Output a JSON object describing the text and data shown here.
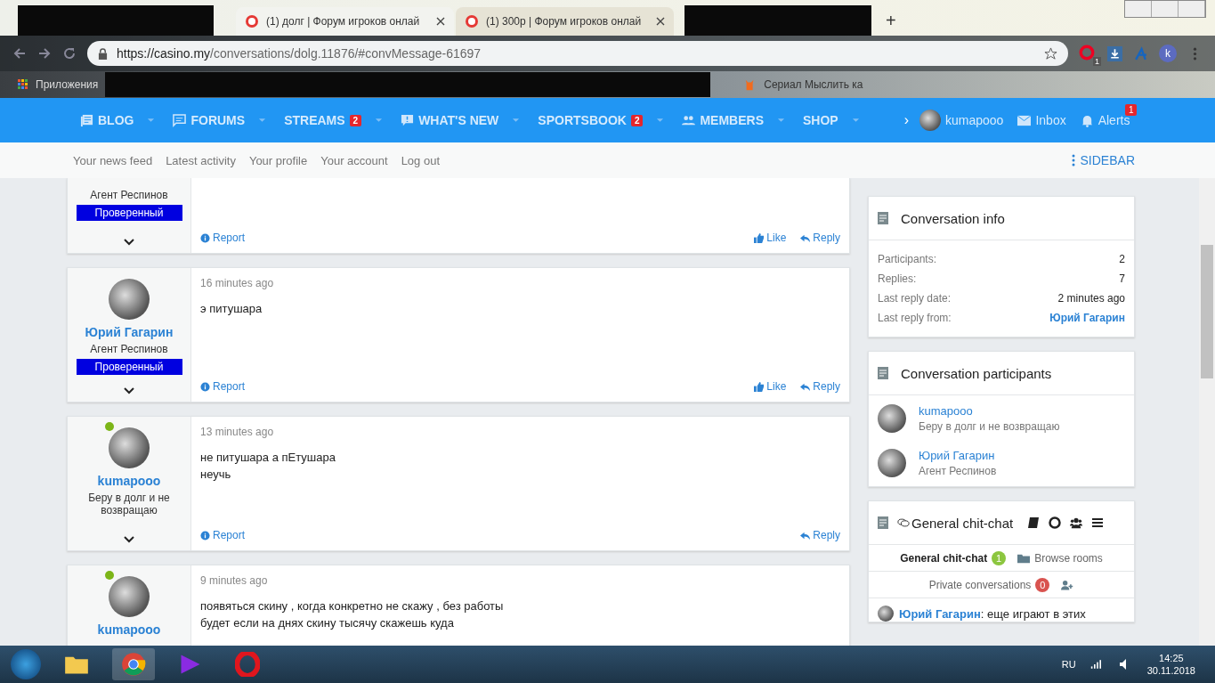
{
  "browser": {
    "tabs": [
      {
        "title": "(1) долг | Форум игроков онлай",
        "selected": true
      },
      {
        "title": "(1) 300р | Форум игроков онлай",
        "selected": false
      }
    ],
    "new_tab": "+",
    "url": {
      "host": "https://casino.my",
      "path": "/conversations/dolg.11876/#convMessage-61697"
    },
    "extension_badge": "1",
    "profile": "k",
    "bookmarks": [
      "Приложения",
      "Сериал Мыслить ка"
    ]
  },
  "nav": {
    "items": [
      {
        "label": "BLOG"
      },
      {
        "label": "FORUMS"
      },
      {
        "label": "STREAMS",
        "badge": "2"
      },
      {
        "label": "WHAT'S NEW"
      },
      {
        "label": "SPORTSBOOK",
        "badge": "2"
      },
      {
        "label": "MEMBERS"
      },
      {
        "label": "SHOP"
      }
    ],
    "more": "›",
    "user": "kumapooo",
    "inbox": "Inbox",
    "alerts": "Alerts",
    "alerts_badge": "1"
  },
  "subnav": {
    "links": [
      "Your news feed",
      "Latest activity",
      "Your profile",
      "Your account",
      "Log out"
    ],
    "sidebar": "SIDEBAR"
  },
  "messages": [
    {
      "role": "Агент Респинов",
      "badge": "Проверенный",
      "report": "Report",
      "like": "Like",
      "reply": "Reply"
    },
    {
      "author": "Юрий Гагарин",
      "role": "Агент Респинов",
      "badge": "Проверенный",
      "time": "16 minutes ago",
      "lines": [
        "э питушара"
      ],
      "report": "Report",
      "like": "Like",
      "reply": "Reply"
    },
    {
      "author": "kumapooo",
      "role": "Беру в долг и не возвращаю",
      "online": true,
      "time": "13 minutes ago",
      "lines": [
        "не питушара а пЕтушара",
        "неучь"
      ],
      "report": "Report",
      "reply": "Reply"
    },
    {
      "author": "kumapooo",
      "online": true,
      "time": "9 minutes ago",
      "lines": [
        "появяться скину , когда конкретно не скажу , без работы",
        "будет если на днях скину тысячу скажешь куда"
      ]
    }
  ],
  "sidebar": {
    "info": {
      "title": "Conversation info",
      "rows": [
        {
          "label": "Participants:",
          "value": "2",
          "link": false
        },
        {
          "label": "Replies:",
          "value": "7",
          "link": false
        },
        {
          "label": "Last reply date:",
          "value": "2 minutes ago",
          "link": false
        },
        {
          "label": "Last reply from:",
          "value": "Юрий Гагарин",
          "link": true
        }
      ]
    },
    "participants": {
      "title": "Conversation participants",
      "people": [
        {
          "name": "kumapooo",
          "role": "Беру в долг и не возвращаю"
        },
        {
          "name": "Юрий Гагарин",
          "role": "Агент Респинов"
        }
      ]
    },
    "chat": {
      "title": "General chit-chat",
      "room": "General chit-chat",
      "room_count": "1",
      "browse": "Browse rooms",
      "private": "Private conversations",
      "private_count": "0",
      "message": {
        "author": "Юрий Гагарин",
        "text": ": еще играют в этих"
      }
    }
  },
  "taskbar": {
    "lang": "RU",
    "time": "14:25",
    "date": "30.11.2018"
  }
}
